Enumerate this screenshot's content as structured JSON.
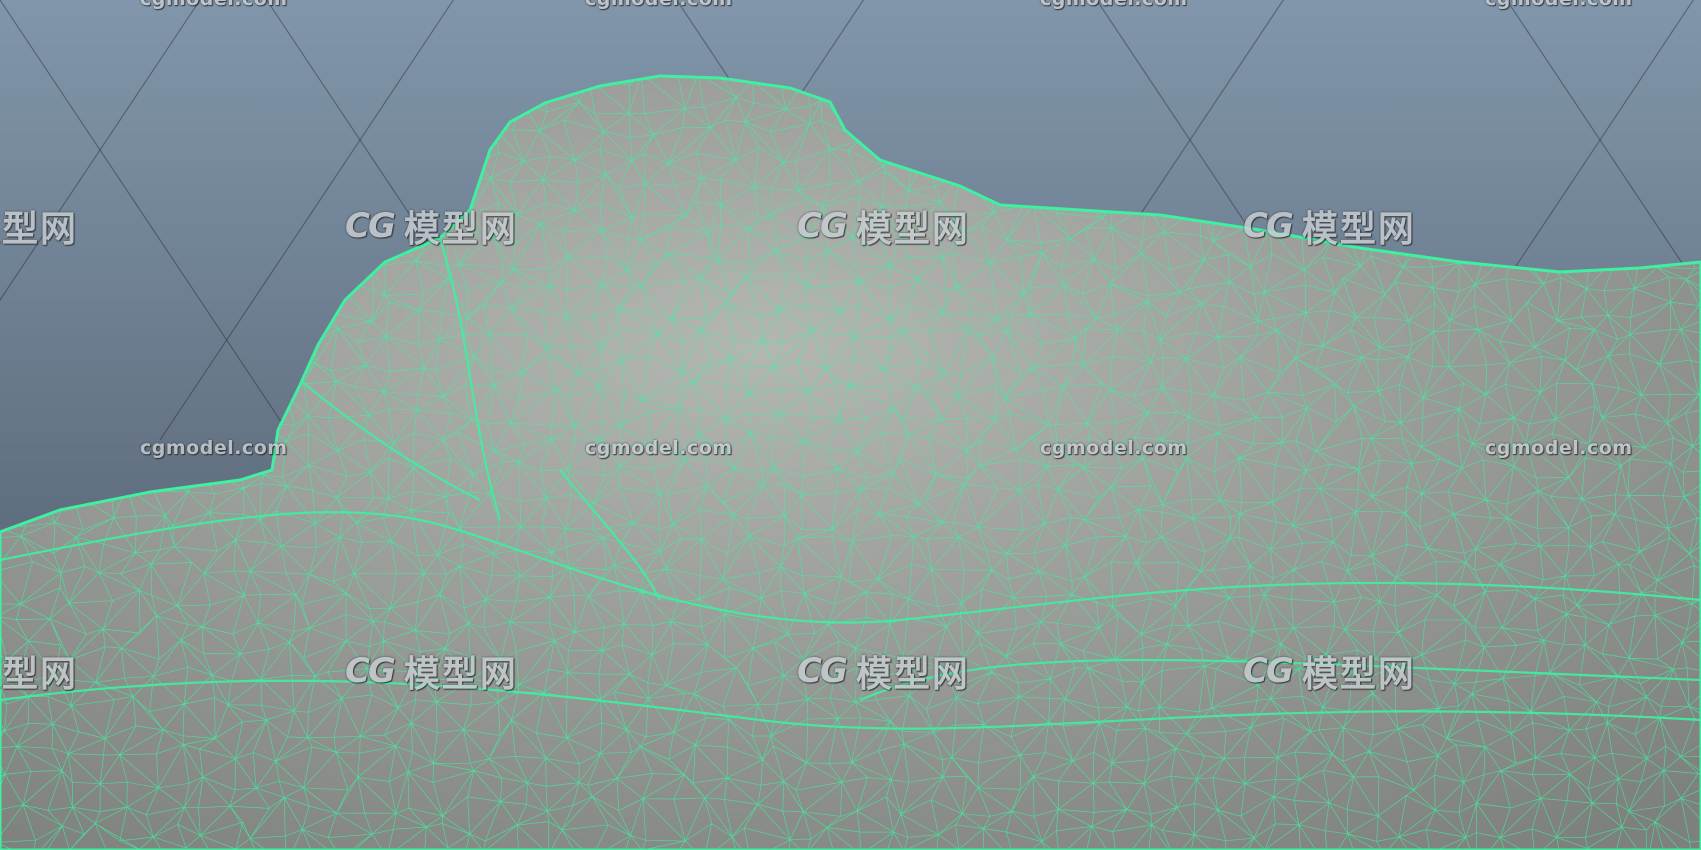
{
  "scene": {
    "background_top": "#8196ab",
    "background_bottom": "#4b5663",
    "mesh_fill": "#a2a4a1",
    "wireframe_color": "#3ef0a0"
  },
  "watermarks": {
    "url_text": "cgmodel.com",
    "logo_mark": "CG",
    "logo_text": "模型网"
  }
}
